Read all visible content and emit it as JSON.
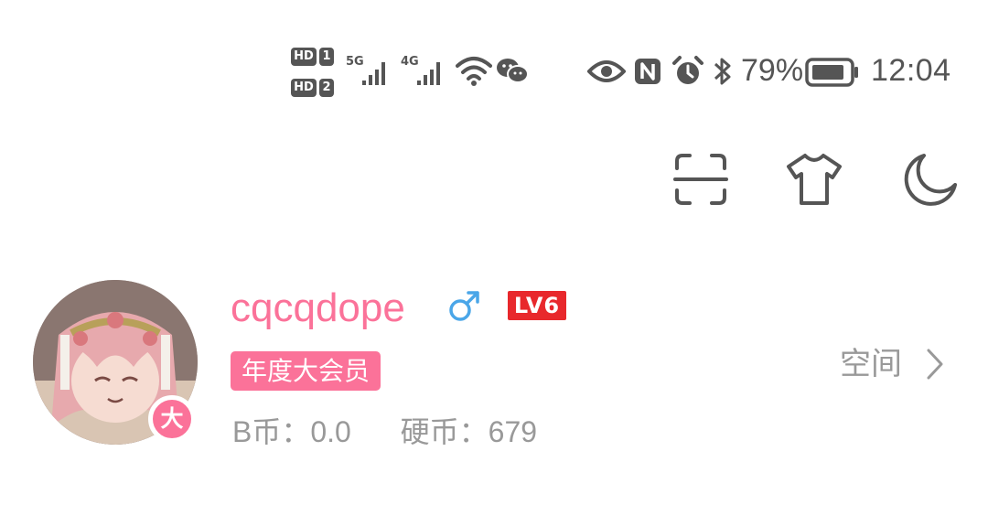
{
  "status_bar": {
    "sim1_label": "HD",
    "sim1_num": "1",
    "sim2_label": "HD",
    "sim2_num": "2",
    "net1": "5G",
    "net2": "4G",
    "battery_percent": "79%",
    "time": "12:04",
    "icons": [
      "wifi-icon",
      "wechat-icon",
      "eye-icon",
      "nfc-icon",
      "alarm-icon",
      "bluetooth-icon",
      "battery-icon"
    ]
  },
  "toolbar": {
    "icons": [
      "scan-icon",
      "theme-shirt-icon",
      "night-mode-icon"
    ]
  },
  "profile": {
    "username": "cqcqdope",
    "gender_symbol": "♂",
    "level": "LV6",
    "vip_avatar_badge": "大",
    "vip_tag": "年度大会员",
    "bcoin_label": "B币：",
    "bcoin_value": "0.0",
    "coin_label": "硬币：",
    "coin_value": "679",
    "space_link": "空间"
  },
  "colors": {
    "accent_pink": "#fb7299",
    "level_red": "#e8282c",
    "gender_blue": "#4aa6e8",
    "icon_gray": "#555555",
    "secondary_text": "#999999"
  }
}
